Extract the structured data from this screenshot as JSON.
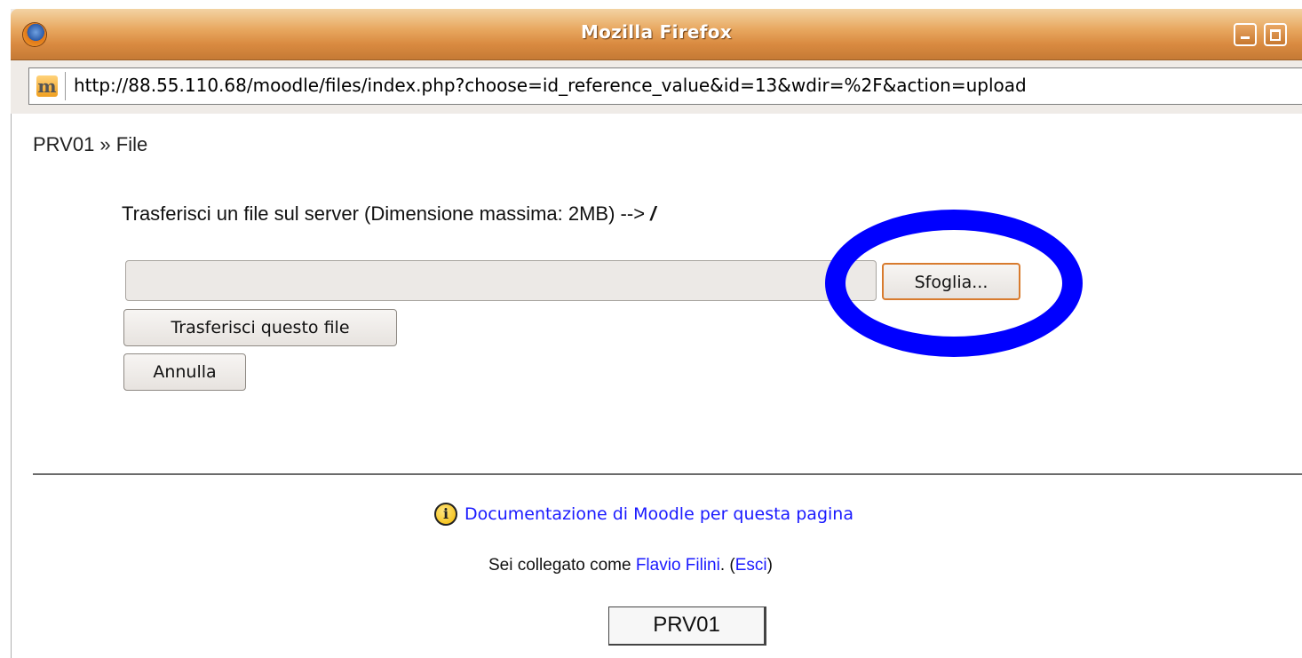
{
  "window": {
    "title": "Mozilla Firefox"
  },
  "address_bar": {
    "url": "http://88.55.110.68/moodle/files/index.php?choose=id_reference_value&id=13&wdir=%2F&action=upload",
    "site_icon": "moodle-icon"
  },
  "page": {
    "breadcrumb": "PRV01 » File",
    "upload_heading": "Trasferisci un file sul server (Dimensione massima: 2MB) --> ",
    "upload_heading_path": "/",
    "file_input_value": "",
    "browse_button": "Sfoglia...",
    "upload_button": "Trasferisci questo file",
    "cancel_button": "Annulla",
    "highlight_color": "#0000ff"
  },
  "footer": {
    "doc_icon": "info-icon",
    "doc_link": "Documentazione di Moodle per questa pagina",
    "logged_in_prefix": "Sei collegato come ",
    "user_name": "Flavio Filini",
    "logged_in_mid": ". (",
    "logout_link": "Esci",
    "logged_in_suffix": ")",
    "course_button": "PRV01"
  }
}
